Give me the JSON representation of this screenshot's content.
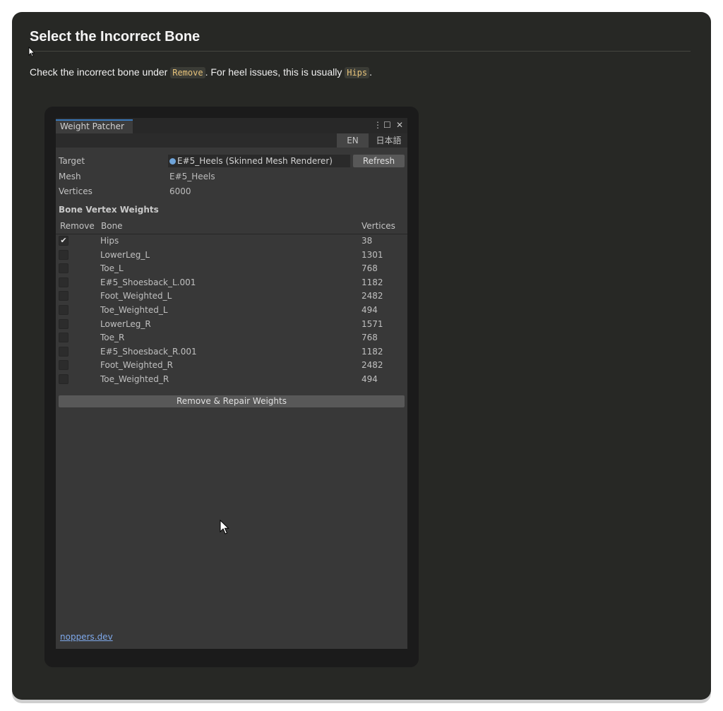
{
  "page": {
    "title": "Select the Incorrect Bone",
    "intro_before": "Check the incorrect bone under",
    "intro_code1": "Remove",
    "intro_middle": ". For heel issues, this is usually",
    "intro_code2": "Hips",
    "intro_after": "."
  },
  "window": {
    "tab_title": "Weight Patcher",
    "window_controls": {
      "menu": "⋮",
      "maximize": "☐",
      "close": "✕"
    },
    "languages": [
      "EN",
      "日本語"
    ],
    "active_language": "EN",
    "fields": {
      "target_label": "Target",
      "target_value": "E#5_Heels (Skinned Mesh Renderer)",
      "refresh_label": "Refresh",
      "mesh_label": "Mesh",
      "mesh_value": "E#5_Heels",
      "vertices_label": "Vertices",
      "vertices_value": "6000"
    },
    "section_title": "Bone Vertex Weights",
    "table_headers": {
      "remove": "Remove",
      "bone": "Bone",
      "vertices": "Vertices"
    },
    "bones": [
      {
        "name": "Hips",
        "vertices": "38",
        "checked": true
      },
      {
        "name": "LowerLeg_L",
        "vertices": "1301",
        "checked": false
      },
      {
        "name": "Toe_L",
        "vertices": "768",
        "checked": false
      },
      {
        "name": "E#5_Shoesback_L.001",
        "vertices": "1182",
        "checked": false
      },
      {
        "name": "Foot_Weighted_L",
        "vertices": "2482",
        "checked": false
      },
      {
        "name": "Toe_Weighted_L",
        "vertices": "494",
        "checked": false
      },
      {
        "name": "LowerLeg_R",
        "vertices": "1571",
        "checked": false
      },
      {
        "name": "Toe_R",
        "vertices": "768",
        "checked": false
      },
      {
        "name": "E#5_Shoesback_R.001",
        "vertices": "1182",
        "checked": false
      },
      {
        "name": "Foot_Weighted_R",
        "vertices": "2482",
        "checked": false
      },
      {
        "name": "Toe_Weighted_R",
        "vertices": "494",
        "checked": false
      }
    ],
    "repair_button": "Remove & Repair Weights",
    "footer_link": "noppers.dev"
  }
}
